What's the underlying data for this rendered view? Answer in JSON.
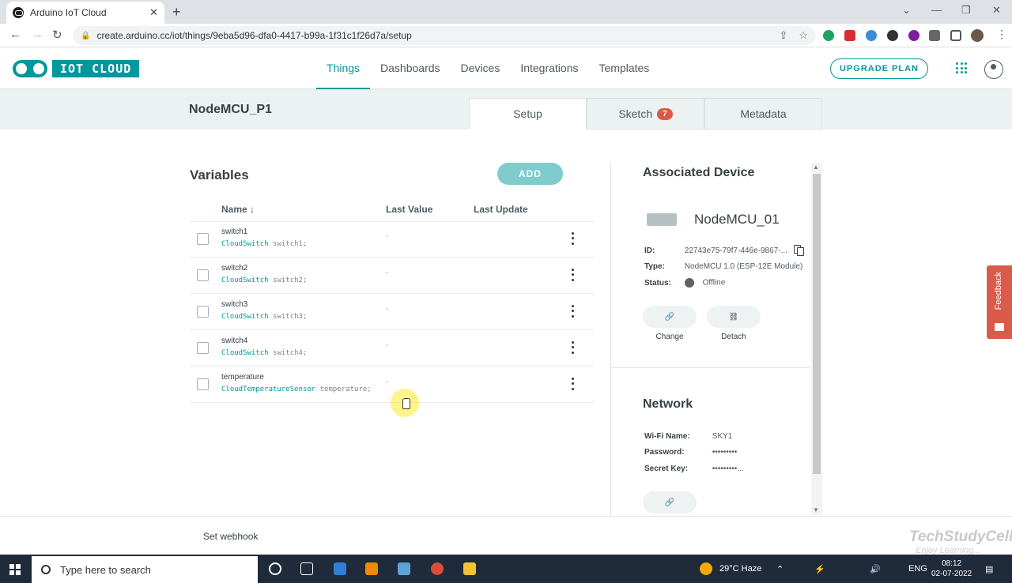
{
  "browser": {
    "tab_title": "Arduino IoT Cloud",
    "url": "create.arduino.cc/iot/things/9eba5d96-dfa0-4417-b99a-1f31c1f26d7a/setup"
  },
  "header": {
    "logo_text": "IOT CLOUD",
    "nav": [
      "Things",
      "Dashboards",
      "Devices",
      "Integrations",
      "Templates"
    ],
    "active_nav": "Things",
    "upgrade_label": "UPGRADE PLAN"
  },
  "thing": {
    "name": "NodeMCU_P1",
    "tabs": [
      {
        "label": "Setup",
        "active": true
      },
      {
        "label": "Sketch",
        "badge": "7"
      },
      {
        "label": "Metadata"
      }
    ]
  },
  "variables": {
    "title": "Variables",
    "add_label": "ADD",
    "columns": {
      "name": "Name",
      "last_value": "Last Value",
      "last_update": "Last Update"
    },
    "rows": [
      {
        "name": "switch1",
        "type": "CloudSwitch",
        "decl": " switch1;",
        "last_value": "-"
      },
      {
        "name": "switch2",
        "type": "CloudSwitch",
        "decl": " switch2;",
        "last_value": "-"
      },
      {
        "name": "switch3",
        "type": "CloudSwitch",
        "decl": " switch3;",
        "last_value": "-"
      },
      {
        "name": "switch4",
        "type": "CloudSwitch",
        "decl": " switch4;",
        "last_value": "-"
      },
      {
        "name": "temperature",
        "type": "CloudTemperatureSensor",
        "decl": " temperature;",
        "last_value": "-"
      }
    ]
  },
  "device": {
    "title": "Associated Device",
    "name": "NodeMCU_01",
    "id_label": "ID:",
    "id_value": "22743e75-79f7-446e-9867-...",
    "type_label": "Type:",
    "type_value": "NodeMCU 1.0 (ESP-12E Module)",
    "status_label": "Status:",
    "status_value": "Offline",
    "change_label": "Change",
    "detach_label": "Detach"
  },
  "network": {
    "title": "Network",
    "wifi_label": "Wi-Fi Name:",
    "wifi_value": "SKY1",
    "password_label": "Password:",
    "password_value": "•••••••••",
    "secret_label": "Secret Key:",
    "secret_value": "•••••••••..."
  },
  "feedback_label": "Feedback",
  "bottom": {
    "webhook_label": "Set webhook",
    "watermark": "TechStudyCell",
    "watermark_sub": "Enjoy Learning..."
  },
  "taskbar": {
    "search_placeholder": "Type here to search",
    "weather": "29°C  Haze",
    "language": "ENG",
    "time": "08:12",
    "date": "02-07-2022"
  },
  "colors": {
    "accent": "#00979d",
    "badge": "#da5b4a",
    "feedback": "#da5b4a"
  }
}
